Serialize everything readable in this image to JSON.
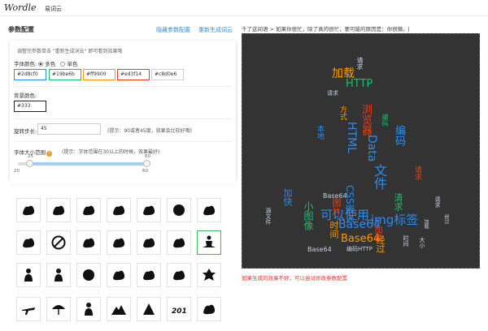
{
  "nav": {
    "logo": "Wordle",
    "item": "易词云"
  },
  "config": {
    "title": "参数配置",
    "hide_link": "隐藏参数配置",
    "regen_link": "重新生成词云",
    "hint": "调整完参数单击 \"重新生成词云\" 即可看到效果哦",
    "font_color_label": "字体颜色:",
    "multi_label": "多色",
    "single_label": "单色",
    "swatches": [
      "#2d8cf0",
      "#19be6b",
      "#ff9900",
      "#ed3f14",
      "#c8d0e6"
    ],
    "bg_label": "背景颜色:",
    "bg_value": "#333",
    "step_label": "旋转步长:",
    "step_value": "45",
    "step_hint": "(提示：90或者45度，效果会比较好哦)",
    "size_label": "字体大小范围",
    "size_hint": "(提示：字体范围在30以上的时候，效果最好)",
    "size_min": "20",
    "size_max": "60",
    "knob_low": "25",
    "knob_high": "60",
    "size_range_low": 20,
    "size_range_high": 60
  },
  "icons": [
    "seahorse-icon",
    "worm-icon",
    "elephant-head-icon",
    "bison-icon",
    "rhino-icon",
    "owl-icon",
    "elephant-icon",
    "horse-rider-icon",
    "griffin-icon",
    "no-fishing-icon",
    "dog-icon",
    "rabbit-icon",
    "map-china-icon",
    "running-horse-icon",
    "meditation-icon",
    "",
    "man-silhouette-icon",
    "woman-silhouette-icon",
    "snail-icon",
    "hare-icon",
    "frog-icon",
    "parrot-icon",
    "maple-leaf-icon",
    "",
    "airplane-icon",
    "umbrella-icon",
    "couple-icon",
    "mountain-icon",
    "eagle-icon",
    "2015-icon",
    "cupid-icon",
    ""
  ],
  "preview": {
    "breadcrumb": "千了这间语 > 如果你很忙，除了真的很忙，要可能的原因是：你很懒。|",
    "footer": "如果生成的效果不好，可以尝试修改参数配置",
    "words": [
      {
        "t": "加载",
        "c": "#ff9900"
      },
      {
        "t": "HTTP",
        "c": "#19be6b"
      },
      {
        "t": "请求",
        "c": "#c8d0e6"
      },
      {
        "t": "请求",
        "c": "#c8d0e6"
      },
      {
        "t": "浏览器",
        "c": "#ed3f14"
      },
      {
        "t": "方式",
        "c": "#ff9900"
      },
      {
        "t": "HTML",
        "c": "#2d8cf0"
      },
      {
        "t": "本地",
        "c": "#2d8cf0"
      },
      {
        "t": "编码",
        "c": "#2d8cf0"
      },
      {
        "t": "Base64",
        "c": "#c8d0e6"
      },
      {
        "t": "img标签",
        "c": "#2d8cf0"
      },
      {
        "t": "可以使用",
        "c": "#2d8cf0"
      },
      {
        "t": "Base64",
        "c": "#2d8cf0"
      },
      {
        "t": "Base64",
        "c": "#ff9900"
      },
      {
        "t": "小图像",
        "c": "#19be6b"
      },
      {
        "t": "CSS嵌入",
        "c": "#2d8cf0"
      },
      {
        "t": "时间",
        "c": "#ff9900"
      },
      {
        "t": "加载",
        "c": "#ed3f14"
      },
      {
        "t": "经过",
        "c": "#ff9900"
      },
      {
        "t": "编码HTTP",
        "c": "#c8d0e6"
      },
      {
        "t": "Base64",
        "c": "#c8d0e6"
      },
      {
        "t": "源文件",
        "c": "#c8d0e6"
      },
      {
        "t": "加快",
        "c": "#2d8cf0"
      },
      {
        "t": "请求",
        "c": "#ed3f14"
      },
      {
        "t": "Data",
        "c": "#2d8cf0"
      },
      {
        "t": "文件",
        "c": "#2d8cf0"
      },
      {
        "t": "清求",
        "c": "#19be6b"
      },
      {
        "t": "请求",
        "c": "#c8d0e6"
      },
      {
        "t": "加载",
        "c": "#c8d0e6"
      },
      {
        "t": "经过",
        "c": "#c8d0e6"
      },
      {
        "t": "时间",
        "c": "#c8d0e6"
      },
      {
        "t": "编码",
        "c": "#19be6b"
      },
      {
        "t": "图片",
        "c": "#ed3f14"
      },
      {
        "t": "大小",
        "c": "#c8d0e6"
      }
    ]
  }
}
